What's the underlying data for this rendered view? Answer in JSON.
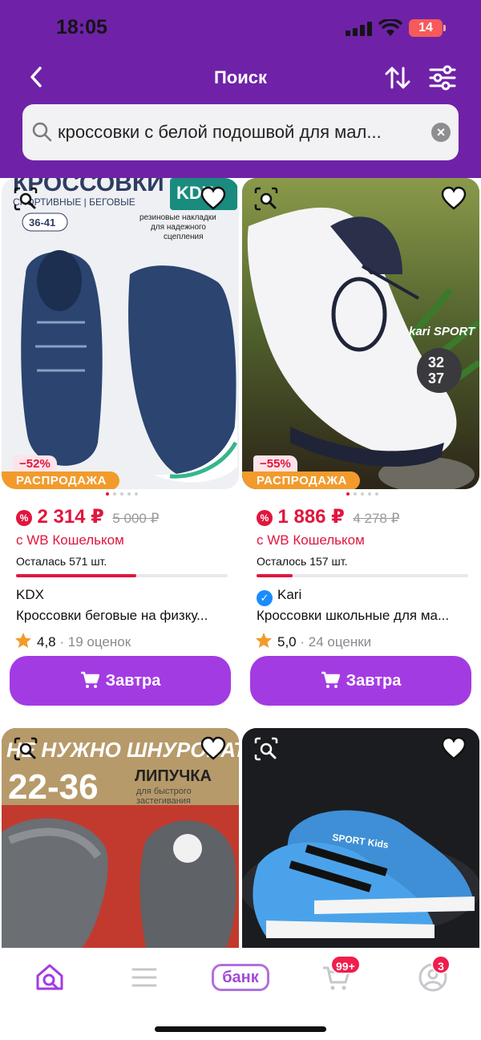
{
  "status_bar": {
    "time": "18:05",
    "battery": "14"
  },
  "header": {
    "title": "Поиск"
  },
  "search": {
    "query": "кроссовки с белой подошвой для мал..."
  },
  "products": [
    {
      "discount": "−52%",
      "sale_label": "РАСПРОДАЖА",
      "price": "2 314 ₽",
      "old_price": "5 000 ₽",
      "wallet": "с WB Кошельком",
      "stock": "Осталась 571 шт.",
      "stock_fraction": 0.57,
      "brand": "KDX",
      "verified": false,
      "title": "Кроссовки беговые на физку...",
      "rating": "4,8",
      "reviews": "· 19 оценок",
      "button": "Завтра",
      "image_overlay": {
        "line1": "КРОССОВКИ",
        "line2": "СПОРТИВНЫЕ | БЕГОВЫЕ",
        "size": "36-41",
        "logo": "KDX",
        "note": "резиновые накладки для надежного сцепления"
      }
    },
    {
      "discount": "−55%",
      "sale_label": "РАСПРОДАЖА",
      "price": "1 886 ₽",
      "old_price": "4 278 ₽",
      "wallet": "с WB Кошельком",
      "stock": "Осталось 157 шт.",
      "stock_fraction": 0.17,
      "brand": "Kari",
      "verified": true,
      "title": "Кроссовки школьные для ма...",
      "rating": "5,0",
      "reviews": "· 24 оценки",
      "button": "Завтра",
      "image_overlay": {
        "logo": "kari SPORT",
        "size_top": "32",
        "size_bottom": "37"
      }
    },
    {
      "image_overlay": {
        "line1": "НЕ НУЖНО ШНУРОВАТЬ",
        "size": "22-36",
        "line2": "ЛИПУЧКА",
        "line3": "для быстрого застегивания"
      }
    },
    {
      "image_overlay": {
        "logo": "SPORT Kids"
      }
    }
  ],
  "bottom_nav": {
    "bank_label": "банк",
    "cart_badge": "99+",
    "profile_badge": "3"
  },
  "colors": {
    "header": "#6f22a8",
    "accent": "#a33be2",
    "price": "#e0163f",
    "sale": "#f29b2c"
  }
}
